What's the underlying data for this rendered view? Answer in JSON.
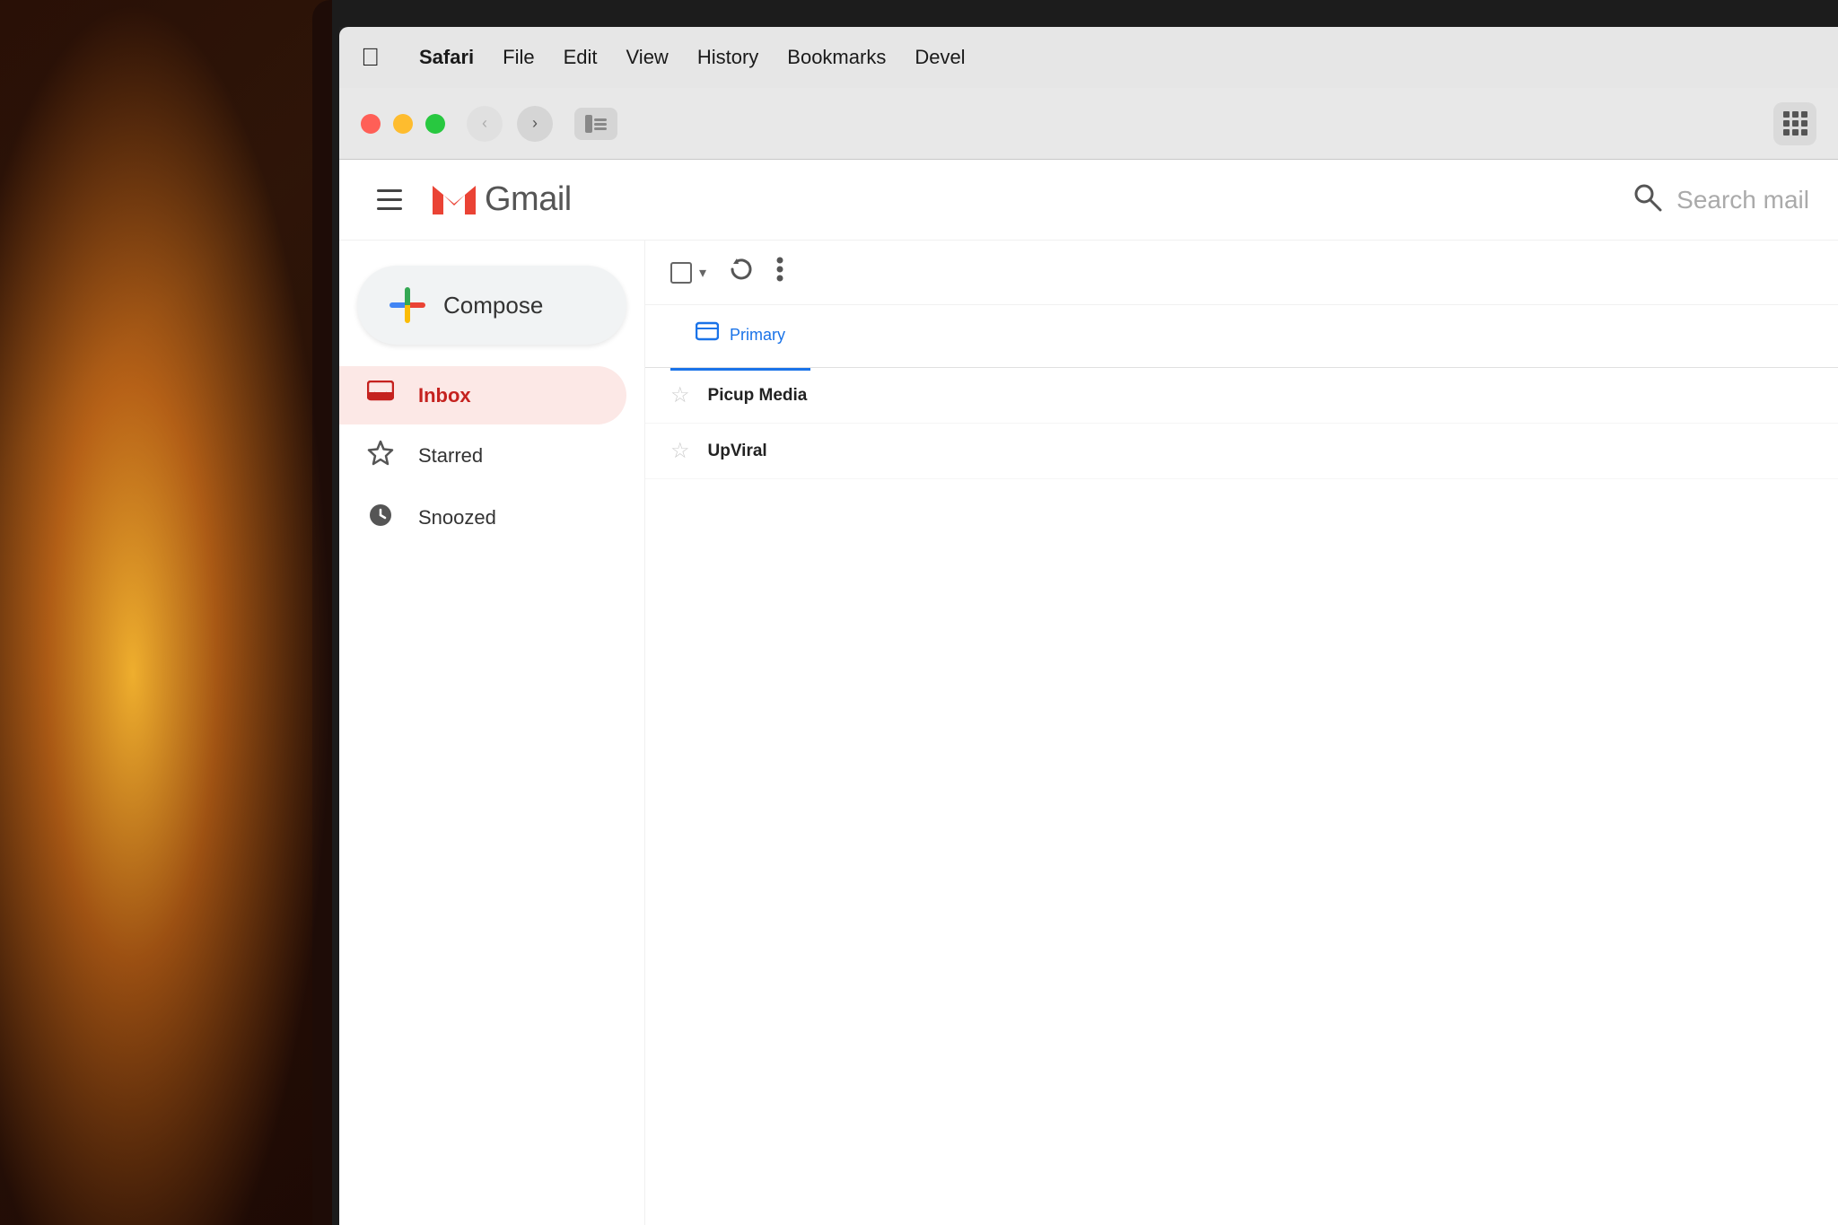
{
  "background": {
    "color": "#1a0a00"
  },
  "menubar": {
    "apple_symbol": "&#63743;",
    "items": [
      {
        "label": "Safari",
        "bold": true
      },
      {
        "label": "File",
        "bold": false
      },
      {
        "label": "Edit",
        "bold": false
      },
      {
        "label": "View",
        "bold": false
      },
      {
        "label": "History",
        "bold": false
      },
      {
        "label": "Bookmarks",
        "bold": false
      },
      {
        "label": "Devel",
        "bold": false
      }
    ]
  },
  "browser": {
    "back_btn": "‹",
    "forward_btn": "›",
    "sidebar_icon": "⊡"
  },
  "gmail": {
    "title": "Gmail",
    "search_placeholder": "Search mail",
    "compose_label": "Compose",
    "nav_items": [
      {
        "label": "Inbox",
        "active": true,
        "icon": "inbox"
      },
      {
        "label": "Starred",
        "active": false,
        "icon": "star"
      },
      {
        "label": "Snoozed",
        "active": false,
        "icon": "clock"
      }
    ],
    "toolbar": {
      "more_label": "⋮",
      "refresh_label": "↻"
    },
    "tabs": [
      {
        "label": "Primary",
        "active": true,
        "icon": "inbox"
      }
    ],
    "emails": [
      {
        "sender": "Picup Media",
        "starred": false
      },
      {
        "sender": "UpViral",
        "starred": false
      }
    ]
  }
}
